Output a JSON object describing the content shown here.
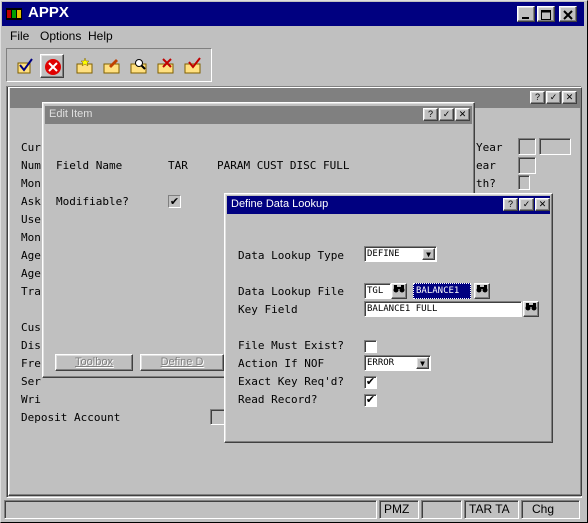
{
  "window": {
    "title": "APPX"
  },
  "menu": [
    "File",
    "Options",
    "Help"
  ],
  "toolbar": {
    "buttons": [
      "check-icon",
      "cancel-icon",
      "folder-new-icon",
      "folder-edit-icon",
      "folder-search-icon",
      "folder-delete-icon",
      "folder-check-icon"
    ]
  },
  "background_form": {
    "labels": [
      "Cur",
      "Num",
      "Mon",
      "Ask",
      "Use",
      "Mon",
      "Age",
      "Age",
      "Tra",
      "Cus",
      "Dis",
      "Fre",
      "Ser",
      "Wri",
      "Deposit Account"
    ],
    "right_labels": [
      "Year",
      "ear",
      "th?"
    ]
  },
  "edit_item": {
    "title": "Edit Item",
    "field_name_label": "Field Name",
    "field_name_value": "TAR",
    "field_desc": "PARAM CUST DISC FULL",
    "modifiable_label": "Modifiable?",
    "modifiable_checked": true,
    "toolbox_button": "Toolbox",
    "define_button": "Define D"
  },
  "define_lookup": {
    "title": "Define Data Lookup",
    "lookup_type_label": "Data Lookup Type",
    "lookup_type_value": "DEFINE",
    "lookup_file_label": "Data Lookup File",
    "lookup_file_app": "TGL",
    "lookup_file_name": "BALANCE1",
    "key_field_label": "Key Field",
    "key_field_value": "BALANCE1 FULL",
    "file_must_exist_label": "File Must Exist?",
    "file_must_exist": false,
    "action_nof_label": "Action If NOF",
    "action_nof_value": "ERROR",
    "exact_key_label": "Exact Key Req'd?",
    "exact_key": true,
    "read_record_label": "Read Record?",
    "read_record": true
  },
  "status": {
    "panel1": "",
    "panel2": "PMZ",
    "panel3": "",
    "panel4": "TAR TA",
    "panel5": "Chg"
  }
}
